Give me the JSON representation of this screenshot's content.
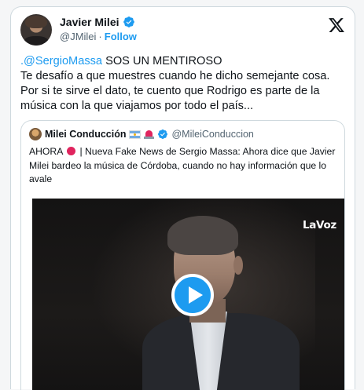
{
  "author": {
    "display_name": "Javier Milei",
    "handle": "@JMilei",
    "separator": "·",
    "follow_label": "Follow",
    "verified": true
  },
  "tweet": {
    "mention": ".@SergioMassa",
    "text_after_mention": " SOS UN MENTIROSO\nTe desafío a que muestres cuando he dicho semejante cosa.\nPor si te sirve el dato, te cuento que Rodrigo es parte de la música con la que viajamos por todo el país..."
  },
  "quote": {
    "display_name": "Milei Conducción",
    "handle": "@MileiConduccion",
    "verified": true,
    "text_before_icon": "AHORA",
    "text_after_icon": "| Nueva Fake News de Sergio Massa: Ahora dice que Javier Milei bardeo la música de Córdoba, cuando no hay información que lo avale",
    "video": {
      "watermark": "LaVoz"
    }
  },
  "icons": {
    "verified": "verified-badge-icon",
    "x_logo": "x-logo-icon",
    "play": "play-icon",
    "flag": "argentina-flag-icon",
    "siren": "siren-icon",
    "red_dot": "red-circle-icon"
  },
  "colors": {
    "accent": "#1d9bf0",
    "text": "#0f1419",
    "muted": "#536471",
    "border": "#cfd9de"
  }
}
